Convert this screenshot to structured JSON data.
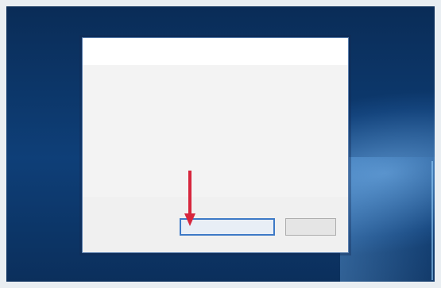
{
  "dialog": {
    "title": "",
    "heading": "",
    "body": "",
    "buttons": {
      "signout_label": "",
      "cancel_label": ""
    }
  },
  "annotation": {
    "arrow_color": "#d7263d",
    "arrow_icon": "arrow-down-icon"
  },
  "colors": {
    "heading": "#2a5aa6",
    "primary_button_border": "#3d79c6",
    "desktop_blue": "#0e3f78"
  }
}
